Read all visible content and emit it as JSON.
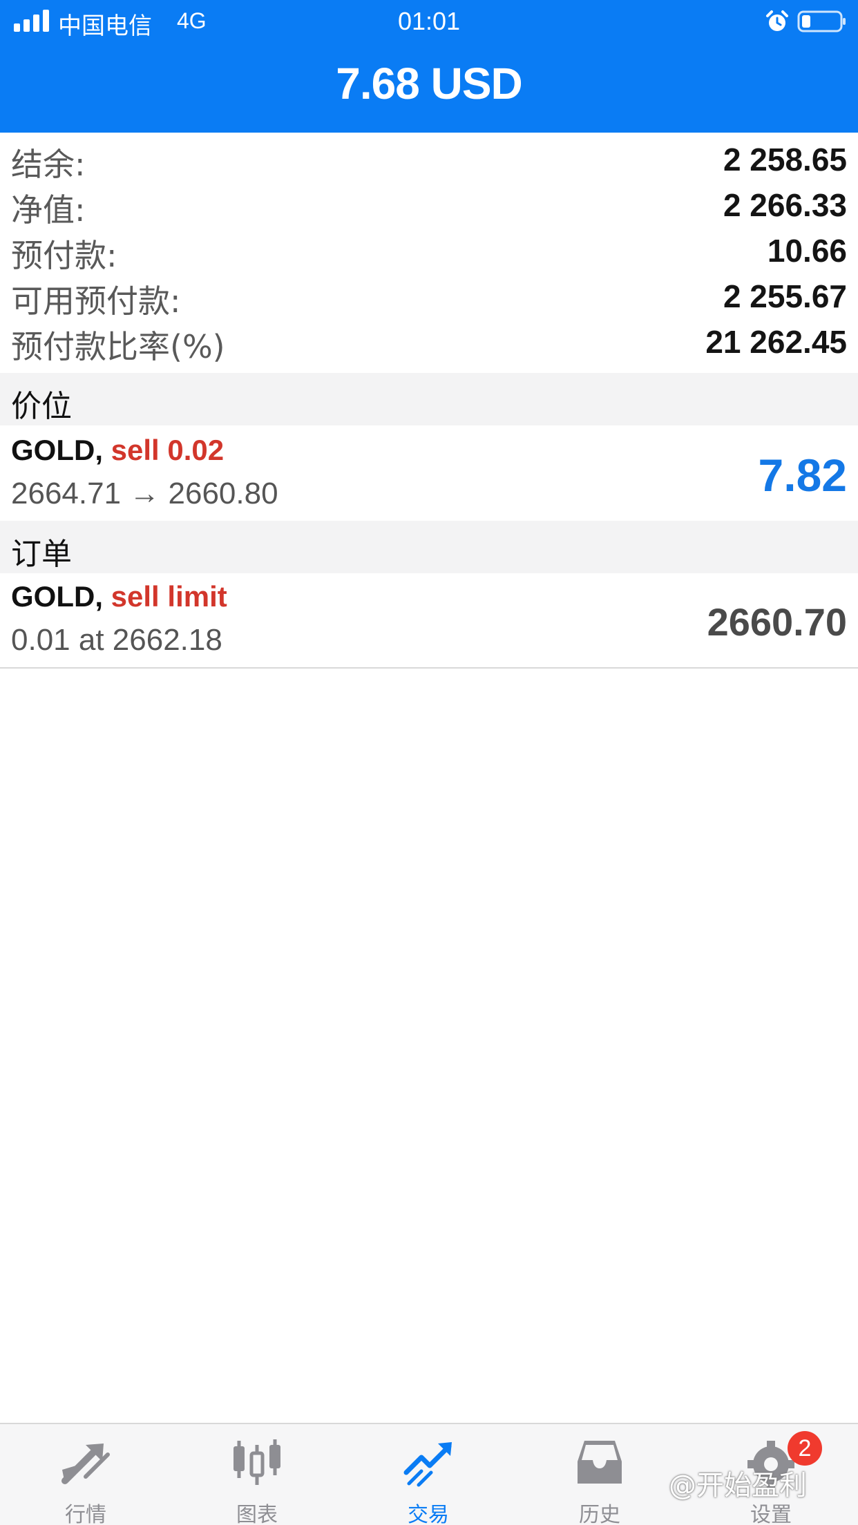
{
  "status_bar": {
    "carrier": "中国电信",
    "network": "4G",
    "time": "01:01"
  },
  "header": {
    "title": "7.68 USD"
  },
  "summary": {
    "rows": [
      {
        "label": "结余:",
        "value": "2 258.65"
      },
      {
        "label": "净值:",
        "value": "2 266.33"
      },
      {
        "label": "预付款:",
        "value": "10.66"
      },
      {
        "label": "可用预付款:",
        "value": "2 255.67"
      },
      {
        "label": "预付款比率(%)",
        "value": "21 262.45"
      }
    ]
  },
  "positions": {
    "title": "价位",
    "items": [
      {
        "symbol": "GOLD,",
        "side": "sell 0.02",
        "prices": "2664.71 → 2660.80",
        "profit": "7.82"
      }
    ]
  },
  "orders": {
    "title": "订单",
    "items": [
      {
        "symbol": "GOLD,",
        "side": "sell limit",
        "detail": "0.01 at 2662.18",
        "price": "2660.70"
      }
    ]
  },
  "tabbar": {
    "tabs": [
      {
        "label": "行情",
        "icon": "quotes-arrows-icon"
      },
      {
        "label": "图表",
        "icon": "candlestick-chart-icon"
      },
      {
        "label": "交易",
        "icon": "trade-trend-icon",
        "active": true
      },
      {
        "label": "历史",
        "icon": "history-inbox-icon"
      },
      {
        "label": "设置",
        "icon": "settings-gear-icon"
      }
    ],
    "settings_badge": "2"
  },
  "watermark": "@开始盈利",
  "colors": {
    "header_blue": "#0a7cf4",
    "sell_red": "#d2362b",
    "profit_blue": "#1478e6",
    "badge_red": "#f03a2e"
  }
}
